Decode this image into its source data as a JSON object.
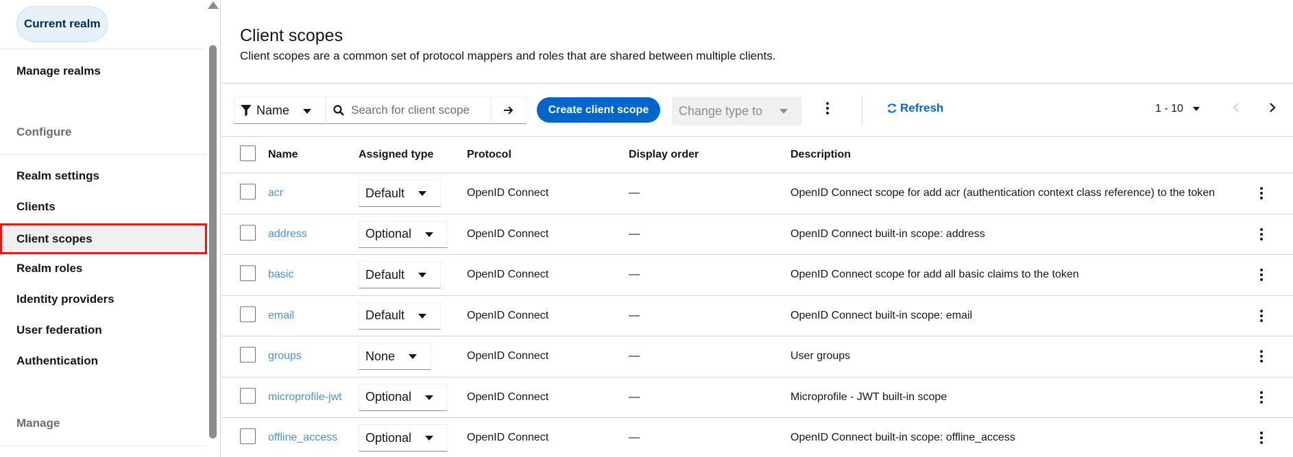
{
  "sidebar": {
    "realm_button": "Current realm",
    "manage_realms": "Manage realms",
    "section_configure": "Configure",
    "items": [
      "Realm settings",
      "Clients",
      "Client scopes",
      "Realm roles",
      "Identity providers",
      "User federation",
      "Authentication"
    ],
    "selected_item": "Client scopes",
    "section_manage": "Manage"
  },
  "header": {
    "title": "Client scopes",
    "description": "Client scopes are a common set of protocol mappers and roles that are shared between multiple clients."
  },
  "toolbar": {
    "filter_label": "Name",
    "search_placeholder": "Search for client scope",
    "create_label": "Create client scope",
    "change_type_label": "Change type to",
    "refresh_label": "Refresh",
    "pagination_label": "1 - 10"
  },
  "table": {
    "columns": [
      "Name",
      "Assigned type",
      "Protocol",
      "Display order",
      "Description"
    ],
    "rows": [
      {
        "name": "acr",
        "type": "Default",
        "protocol": "OpenID Connect",
        "order": "—",
        "description": "OpenID Connect scope for add acr (authentication context class reference) to the token"
      },
      {
        "name": "address",
        "type": "Optional",
        "protocol": "OpenID Connect",
        "order": "—",
        "description": "OpenID Connect built-in scope: address"
      },
      {
        "name": "basic",
        "type": "Default",
        "protocol": "OpenID Connect",
        "order": "—",
        "description": "OpenID Connect scope for add all basic claims to the token"
      },
      {
        "name": "email",
        "type": "Default",
        "protocol": "OpenID Connect",
        "order": "—",
        "description": "OpenID Connect built-in scope: email"
      },
      {
        "name": "groups",
        "type": "None",
        "protocol": "OpenID Connect",
        "order": "—",
        "description": "User groups"
      },
      {
        "name": "microprofile-jwt",
        "type": "Optional",
        "protocol": "OpenID Connect",
        "order": "—",
        "description": "Microprofile - JWT built-in scope"
      },
      {
        "name": "offline_access",
        "type": "Optional",
        "protocol": "OpenID Connect",
        "order": "—",
        "description": "OpenID Connect built-in scope: offline_access"
      }
    ]
  },
  "icons": {
    "filter": "filter-icon",
    "search": "search-icon",
    "go": "arrow-right-icon",
    "refresh": "sync-icon",
    "kebab": "kebab-icon",
    "prev": "angle-left-icon",
    "next": "angle-right-icon"
  },
  "colors": {
    "primary": "#0066cc",
    "link": "#4a90e2",
    "selection_outline": "#e3161b"
  }
}
